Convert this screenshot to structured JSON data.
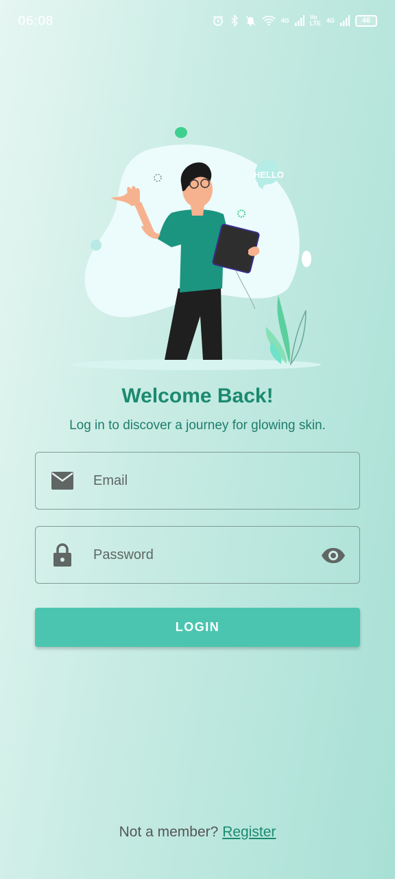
{
  "status_bar": {
    "time": "06:08",
    "network_1": "4G",
    "network_2_top": "Vo",
    "network_2_bottom": "LTE",
    "network_3": "4G",
    "battery": "46"
  },
  "illustration": {
    "speech_bubble": "HELLO"
  },
  "header": {
    "title": "Welcome Back!",
    "subtitle": "Log in to discover a journey for glowing skin."
  },
  "form": {
    "email_placeholder": "Email",
    "password_placeholder": "Password",
    "login_label": "LOGIN"
  },
  "footer": {
    "prompt": "Not a member?",
    "register_label": "Register"
  },
  "colors": {
    "accent": "#4cc5b0",
    "title": "#1b8a70",
    "shirt": "#1b9580"
  }
}
